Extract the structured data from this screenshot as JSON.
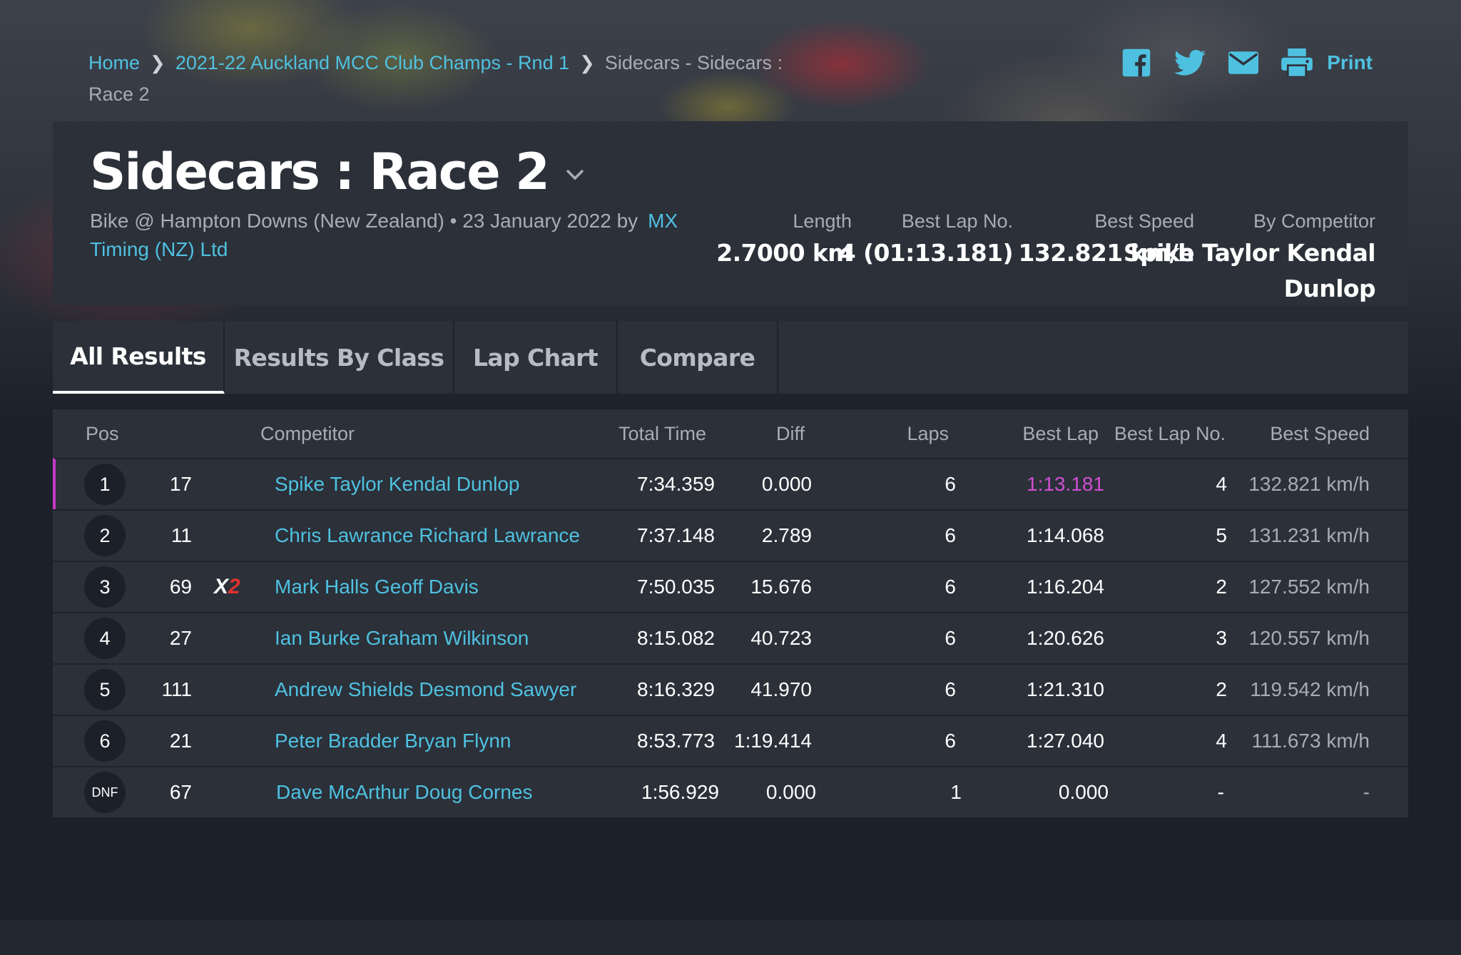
{
  "breadcrumb": {
    "home": "Home",
    "event": "2021-22 Auckland MCC Club Champs - Rnd 1",
    "current": "Sidecars - Sidecars : Race 2"
  },
  "share": {
    "print_label": "Print",
    "icons": [
      "facebook-icon",
      "twitter-icon",
      "email-icon",
      "printer-icon"
    ]
  },
  "race": {
    "title": "Sidecars : Race 2",
    "meta": "Bike @ Hampton Downs (New Zealand) • 23 January 2022 by",
    "organizer": "MX Timing (NZ) Ltd",
    "stats": {
      "length_label": "Length",
      "length": "2.7000 km",
      "best_lap_no_label": "Best Lap No.",
      "best_lap_no": "4 (01:13.181)",
      "best_speed_label": "Best Speed",
      "best_speed": "132.821 km/h",
      "by_competitor_label": "By Competitor",
      "by_competitor_line1": "Spike Taylor Kendal",
      "by_competitor_line2": "Dunlop"
    }
  },
  "tabs": [
    {
      "label": "All Results",
      "active": true
    },
    {
      "label": "Results By Class",
      "active": false
    },
    {
      "label": "Lap Chart",
      "active": false
    },
    {
      "label": "Compare",
      "active": false
    }
  ],
  "table": {
    "headers": {
      "pos": "Pos",
      "competitor": "Competitor",
      "total_time": "Total Time",
      "diff": "Diff",
      "laps": "Laps",
      "best_lap": "Best Lap",
      "best_lap_no": "Best Lap No.",
      "best_speed": "Best Speed"
    },
    "rows": [
      {
        "pos": "1",
        "num": "17",
        "class_badge": "",
        "competitor": "Spike Taylor Kendal Dunlop",
        "total_time": "7:34.359",
        "diff": "0.000",
        "laps": "6",
        "best_lap": "1:13.181",
        "best_lap_no": "4",
        "best_speed": "132.821 km/h"
      },
      {
        "pos": "2",
        "num": "11",
        "class_badge": "",
        "competitor": "Chris Lawrance Richard Lawrance",
        "total_time": "7:37.148",
        "diff": "2.789",
        "laps": "6",
        "best_lap": "1:14.068",
        "best_lap_no": "5",
        "best_speed": "131.231 km/h"
      },
      {
        "pos": "3",
        "num": "69",
        "class_badge": "X2",
        "competitor": "Mark Halls Geoff Davis",
        "total_time": "7:50.035",
        "diff": "15.676",
        "laps": "6",
        "best_lap": "1:16.204",
        "best_lap_no": "2",
        "best_speed": "127.552 km/h"
      },
      {
        "pos": "4",
        "num": "27",
        "class_badge": "",
        "competitor": "Ian Burke Graham Wilkinson",
        "total_time": "8:15.082",
        "diff": "40.723",
        "laps": "6",
        "best_lap": "1:20.626",
        "best_lap_no": "3",
        "best_speed": "120.557 km/h"
      },
      {
        "pos": "5",
        "num": "111",
        "class_badge": "",
        "competitor": "Andrew Shields Desmond Sawyer",
        "total_time": "8:16.329",
        "diff": "41.970",
        "laps": "6",
        "best_lap": "1:21.310",
        "best_lap_no": "2",
        "best_speed": "119.542 km/h"
      },
      {
        "pos": "6",
        "num": "21",
        "class_badge": "",
        "competitor": "Peter Bradder Bryan Flynn",
        "total_time": "8:53.773",
        "diff": "1:19.414",
        "laps": "6",
        "best_lap": "1:27.040",
        "best_lap_no": "4",
        "best_speed": "111.673 km/h"
      },
      {
        "pos": "DNF",
        "num": "67",
        "class_badge": "",
        "competitor": "Dave McArthur Doug Cornes",
        "total_time": "1:56.929",
        "diff": "0.000",
        "laps": "1",
        "best_lap": "0.000",
        "best_lap_no": "-",
        "best_speed": "-"
      }
    ]
  },
  "colors": {
    "accent": "#4fc1e0",
    "best_lap": "#d14fd0",
    "leader_bar": "#c43ac6",
    "panel": "#2b3039",
    "background": "#1c2029"
  }
}
